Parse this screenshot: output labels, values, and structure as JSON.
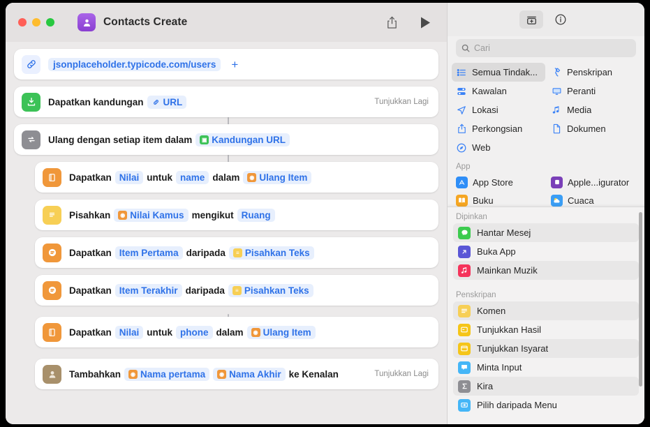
{
  "window": {
    "title": "Contacts Create",
    "traffic_lights": [
      "close",
      "minimize",
      "zoom"
    ],
    "colors": {
      "close": "#ff5f57",
      "minimize": "#febc2e",
      "zoom": "#28c840",
      "accent_blue": "#2f72e8",
      "app_purple": "#8a3fd1"
    },
    "toolbar": {
      "share_icon": "share-icon",
      "run_icon": "play-icon"
    }
  },
  "editor": {
    "rows": [
      {
        "id": "url-action",
        "icon": "link-icon",
        "icon_style": "link",
        "parts": [
          {
            "type": "url-chip",
            "text": "jsonplaceholder.typicode.com/users"
          },
          {
            "type": "plus",
            "text": "+"
          }
        ],
        "show_more": ""
      },
      {
        "id": "get-contents-of-url",
        "icon": "download-icon",
        "icon_style": "green",
        "parts": [
          {
            "type": "text",
            "text": "Dapatkan kandungan"
          },
          {
            "type": "chip-link",
            "text": "URL"
          }
        ],
        "show_more": "Tunjukkan Lagi"
      },
      {
        "id": "repeat-with-each",
        "icon": "repeat-icon",
        "icon_style": "gray",
        "parts": [
          {
            "type": "text",
            "text": "Ulang dengan setiap item dalam"
          },
          {
            "type": "var-green",
            "text": "Kandungan URL"
          }
        ],
        "show_more": ""
      },
      {
        "id": "get-value-name",
        "icon": "dictionary-icon",
        "icon_style": "orange",
        "indent": true,
        "parts": [
          {
            "type": "text",
            "text": "Dapatkan"
          },
          {
            "type": "chip",
            "text": "Nilai"
          },
          {
            "type": "text",
            "text": "untuk"
          },
          {
            "type": "chip",
            "text": "name"
          },
          {
            "type": "text",
            "text": "dalam"
          },
          {
            "type": "var-orange",
            "text": "Ulang Item"
          }
        ],
        "show_more": ""
      },
      {
        "id": "split-text",
        "icon": "text-lines-icon",
        "icon_style": "yellow",
        "indent": true,
        "parts": [
          {
            "type": "text",
            "text": "Pisahkan"
          },
          {
            "type": "var-orange",
            "text": "Nilai Kamus"
          },
          {
            "type": "text",
            "text": "mengikut"
          },
          {
            "type": "chip",
            "text": "Ruang"
          }
        ],
        "show_more": ""
      },
      {
        "id": "get-first-item",
        "icon": "list-icon",
        "icon_style": "orange",
        "indent": true,
        "parts": [
          {
            "type": "text",
            "text": "Dapatkan"
          },
          {
            "type": "chip",
            "text": "Item Pertama"
          },
          {
            "type": "text",
            "text": "daripada"
          },
          {
            "type": "var-yellow",
            "text": "Pisahkan Teks"
          }
        ],
        "show_more": ""
      },
      {
        "id": "get-last-item",
        "icon": "list-icon",
        "icon_style": "orange",
        "indent": true,
        "parts": [
          {
            "type": "text",
            "text": "Dapatkan"
          },
          {
            "type": "chip",
            "text": "Item Terakhir"
          },
          {
            "type": "text",
            "text": "daripada"
          },
          {
            "type": "var-yellow",
            "text": "Pisahkan Teks"
          }
        ],
        "show_more": ""
      },
      {
        "id": "get-value-phone",
        "icon": "dictionary-icon",
        "icon_style": "orange",
        "indent": true,
        "gap": true,
        "parts": [
          {
            "type": "text",
            "text": "Dapatkan"
          },
          {
            "type": "chip",
            "text": "Nilai"
          },
          {
            "type": "text",
            "text": "untuk"
          },
          {
            "type": "chip",
            "text": "phone"
          },
          {
            "type": "text",
            "text": "dalam"
          },
          {
            "type": "var-orange",
            "text": "Ulang Item"
          }
        ],
        "show_more": ""
      },
      {
        "id": "add-contact",
        "icon": "contact-icon",
        "icon_style": "contact",
        "indent": true,
        "gap": true,
        "parts": [
          {
            "type": "text",
            "text": "Tambahkan"
          },
          {
            "type": "var-orange",
            "text": "Nama pertama"
          },
          {
            "type": "var-orange",
            "text": "Nama Akhir"
          },
          {
            "type": "text",
            "text": "ke Kenalan"
          }
        ],
        "show_more": "Tunjukkan Lagi"
      }
    ]
  },
  "panel": {
    "tabs": [
      {
        "name": "action-library-tab",
        "icon": "action-library-icon",
        "active": true
      },
      {
        "name": "info-tab",
        "icon": "info-circle-icon",
        "active": false
      }
    ],
    "search": {
      "placeholder": "Cari",
      "value": "",
      "icon": "search-icon"
    },
    "categories": [
      {
        "label": "Semua Tindak...",
        "icon": "list-bullet-icon",
        "active": true
      },
      {
        "label": "Penskripan",
        "icon": "scripting-icon",
        "active": false
      },
      {
        "label": "Kawalan",
        "icon": "controls-icon",
        "active": false
      },
      {
        "label": "Peranti",
        "icon": "display-icon",
        "active": false
      },
      {
        "label": "Lokasi",
        "icon": "location-arrow-icon",
        "active": false
      },
      {
        "label": "Media",
        "icon": "music-note-icon",
        "active": false
      },
      {
        "label": "Perkongsian",
        "icon": "share-icon",
        "active": false
      },
      {
        "label": "Dokumen",
        "icon": "document-icon",
        "active": false
      },
      {
        "label": "Web",
        "icon": "safari-compass-icon",
        "active": false
      }
    ],
    "app_section": {
      "header": "App",
      "items": [
        {
          "label": "App Store",
          "icon": "app-store-icon",
          "color": "#2f8ef7"
        },
        {
          "label": "Apple...igurator",
          "icon": "apple-configurator-icon",
          "color": "#7a3fb8"
        },
        {
          "label": "Buku",
          "icon": "books-icon",
          "color": "#f5a623"
        },
        {
          "label": "Cuaca",
          "icon": "weather-icon",
          "color": "#3b9ef5"
        }
      ]
    },
    "pinned_section": {
      "header": "Dipinkan",
      "items": [
        {
          "label": "Hantar Mesej",
          "icon": "messages-icon",
          "color": "#3ccb4e",
          "alt": true
        },
        {
          "label": "Buka App",
          "icon": "open-app-icon",
          "color": "#5a56d6",
          "alt": false
        },
        {
          "label": "Mainkan Muzik",
          "icon": "music-icon",
          "color": "#f5335b",
          "alt": true
        }
      ]
    },
    "scripting_section": {
      "header": "Penskripan",
      "items": [
        {
          "label": "Komen",
          "icon": "comment-icon",
          "color": "#f7cf55",
          "alt": true
        },
        {
          "label": "Tunjukkan Hasil",
          "icon": "show-result-icon",
          "color": "#f5c518",
          "alt": false
        },
        {
          "label": "Tunjukkan Isyarat",
          "icon": "show-alert-icon",
          "color": "#f5c518",
          "alt": true
        },
        {
          "label": "Minta Input",
          "icon": "ask-input-icon",
          "color": "#45b6f7",
          "alt": false
        },
        {
          "label": "Kira",
          "icon": "calculate-icon",
          "color": "#8e8e93",
          "alt": true
        },
        {
          "label": "Pilih daripada Menu",
          "icon": "choose-menu-icon",
          "color": "#45b6f7",
          "alt": false
        }
      ]
    }
  }
}
